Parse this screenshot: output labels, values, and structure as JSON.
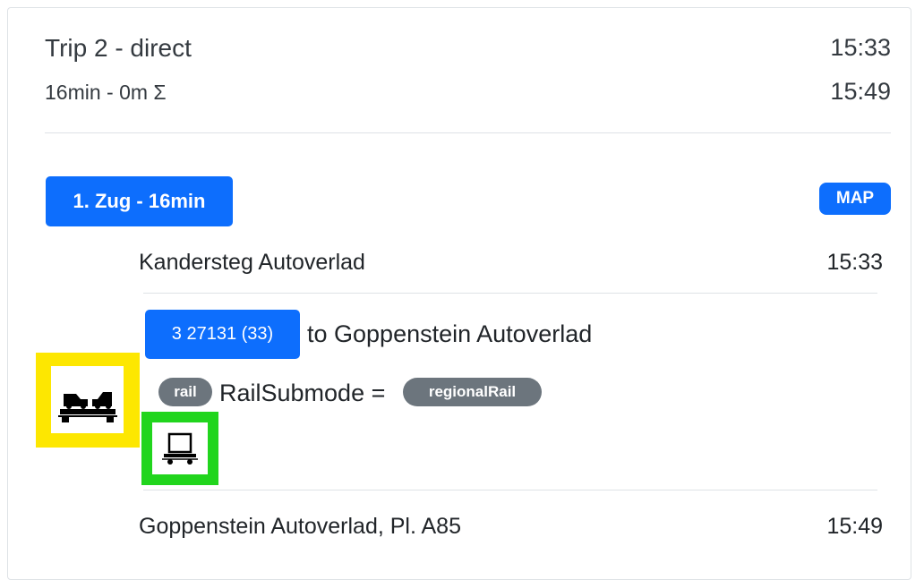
{
  "trip": {
    "title": "Trip 2 - direct",
    "summary": "16min - 0m Σ",
    "depart_time": "15:33",
    "arrive_time": "15:49"
  },
  "leg": {
    "label": "1. Zug - 16min",
    "map_button": "MAP",
    "from_stop": "Kandersteg Autoverlad",
    "from_time": "15:33",
    "line": "3 27131 (33)",
    "direction": "to Goppenstein Autoverlad",
    "mode": "rail",
    "submode_label": "RailSubmode =",
    "submode": "regionalRail",
    "to_stop": "Goppenstein Autoverlad, Pl. A85",
    "to_time": "15:49"
  },
  "icons": {
    "car_train": "car-carrier-train-icon",
    "wagon": "flat-wagon-icon",
    "accent_yellow": "#fde701",
    "accent_green": "#21d51d",
    "accent_blue": "#0d6efd",
    "pill_gray": "#6c757d"
  }
}
